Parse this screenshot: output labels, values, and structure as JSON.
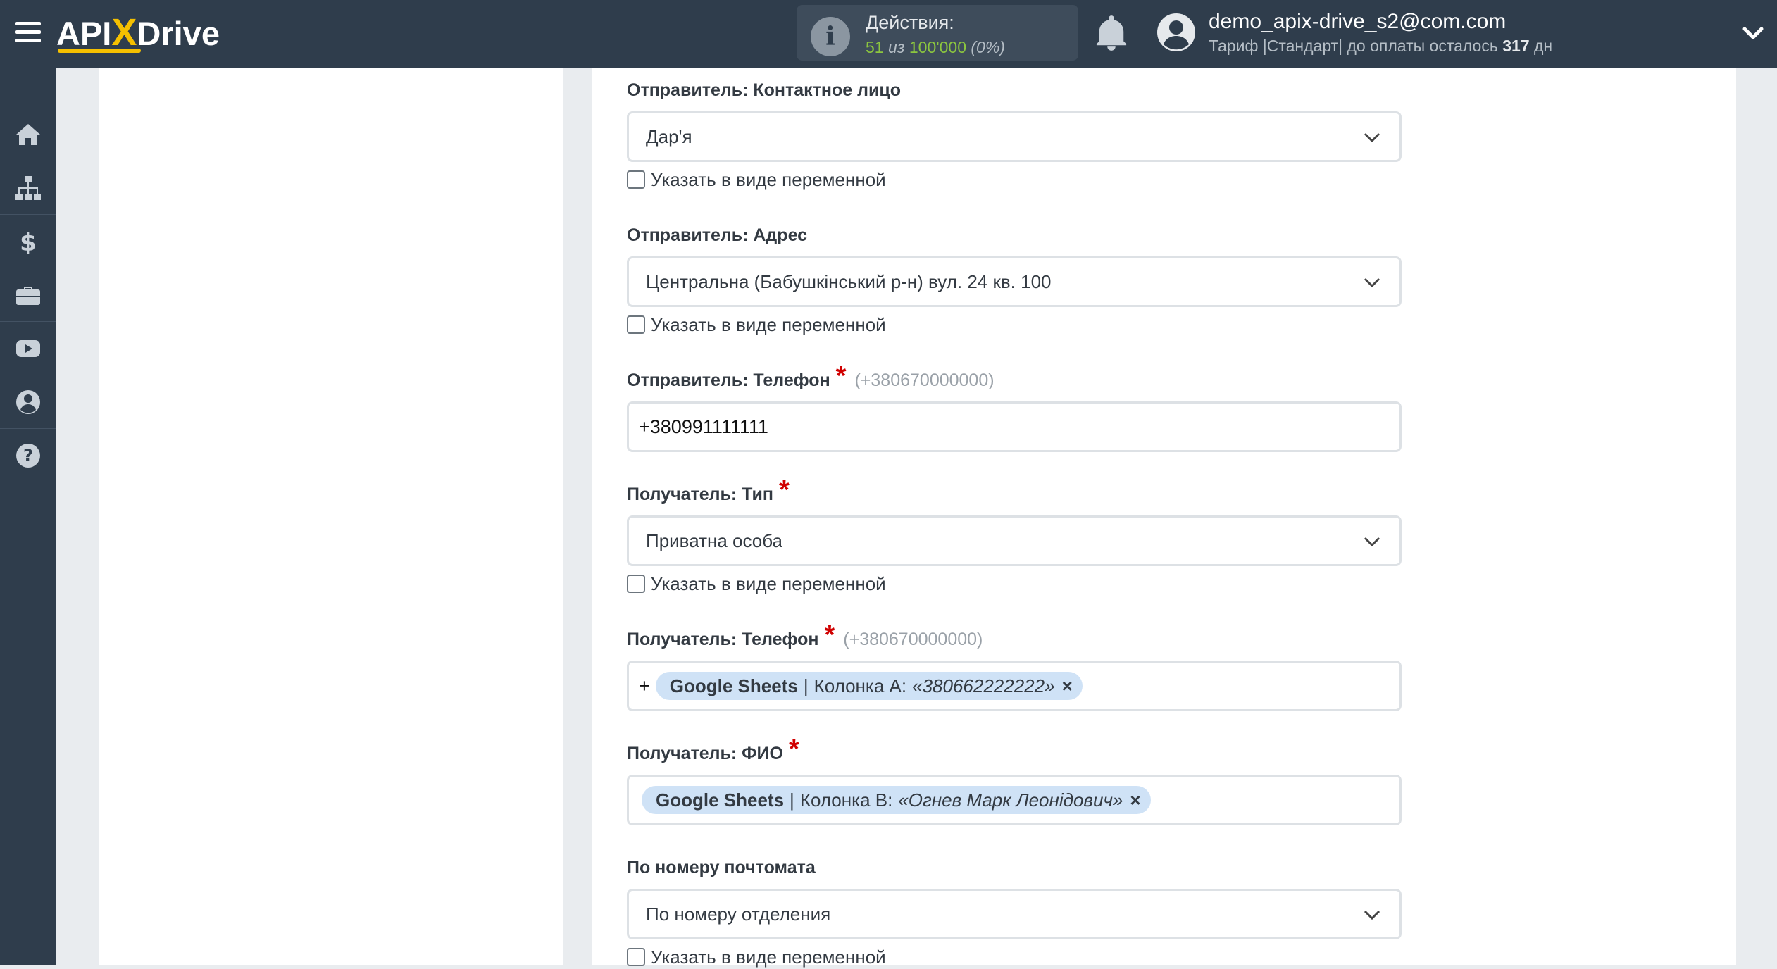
{
  "header": {
    "logo": {
      "part1": "API",
      "part2": "X",
      "part3": "Drive"
    },
    "actions": {
      "title": "Действия:",
      "used": "51",
      "of_word": "из",
      "total": "100'000",
      "percent": "(0%)"
    },
    "user": {
      "email": "demo_apix-drive_s2@com.com",
      "plan_prefix": "Тариф |Стандарт| до оплаты осталось",
      "days": "317",
      "days_unit": "дн"
    }
  },
  "sidebar": {
    "items": [
      {
        "icon": "home-icon"
      },
      {
        "icon": "sitemap-icon"
      },
      {
        "icon": "dollar-icon"
      },
      {
        "icon": "briefcase-icon"
      },
      {
        "icon": "youtube-icon"
      },
      {
        "icon": "user-circle-icon"
      },
      {
        "icon": "question-icon"
      }
    ]
  },
  "form": {
    "sender_contact": {
      "label": "Отправитель: Контактное лицо",
      "value": "Дар'я",
      "checkbox_label": "Указать в виде переменной"
    },
    "sender_address": {
      "label": "Отправитель: Адрес",
      "value": "Центральна (Бабушкінський р-н) вул. 24 кв. 100",
      "checkbox_label": "Указать в виде переменной"
    },
    "sender_phone": {
      "label": "Отправитель: Телефон",
      "required_mark": "*",
      "hint": "(+380670000000)",
      "value": "+380991111111"
    },
    "recipient_type": {
      "label": "Получатель: Тип",
      "required_mark": "*",
      "value": "Приватна особа",
      "checkbox_label": "Указать в виде переменной"
    },
    "recipient_phone": {
      "label": "Получатель: Телефон",
      "required_mark": "*",
      "hint": "(+380670000000)",
      "prefix": "+",
      "tag_source": "Google Sheets",
      "tag_sep": "|",
      "tag_column": "Колонка A:",
      "tag_value": "«380662222222»",
      "tag_remove": "×"
    },
    "recipient_name": {
      "label": "Получатель: ФИО",
      "required_mark": "*",
      "tag_source": "Google Sheets",
      "tag_sep": "|",
      "tag_column": "Колонка B:",
      "tag_value": "«Огнев Марк Леонідович»",
      "tag_remove": "×"
    },
    "postomat": {
      "label": "По номеру почтомата",
      "value": "По номеру отделения",
      "checkbox_label": "Указать в виде переменной"
    }
  },
  "colors": {
    "topbar": "#2f3d4c",
    "accent_yellow": "#f5c000",
    "green": "#8cc63f",
    "required": "#d00000",
    "tag_bg": "#cfe2f6"
  }
}
